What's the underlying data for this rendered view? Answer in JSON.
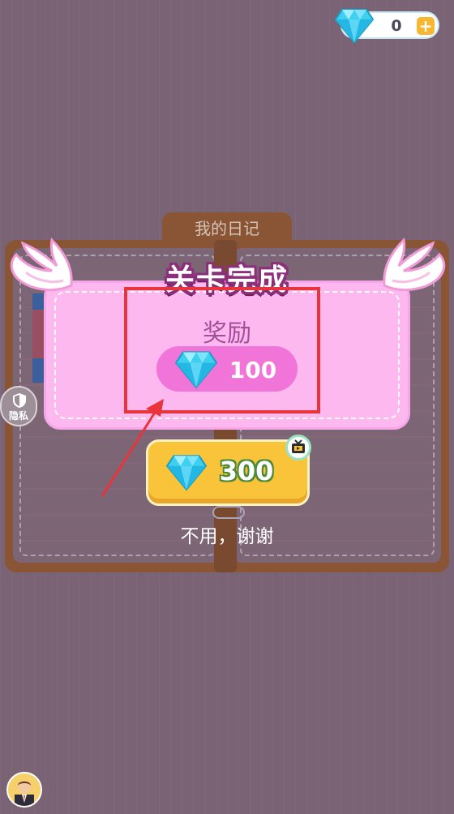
{
  "top_bar": {
    "gem_count": "0",
    "add_icon": "plus-icon"
  },
  "diary": {
    "title": "我的日记"
  },
  "side": {
    "privacy_label": "隐私"
  },
  "reward_dialog": {
    "title": "关卡完成",
    "reward_label": "奖励",
    "reward_amount": "100",
    "ad_reward_amount": "300",
    "decline_label": "不用，谢谢"
  },
  "colors": {
    "background": "#7a6374",
    "panel_pink": "#fdb8ef",
    "pill_pink": "#f174d8",
    "button_yellow": "#f9c33a",
    "highlight_red": "#e8343a"
  }
}
